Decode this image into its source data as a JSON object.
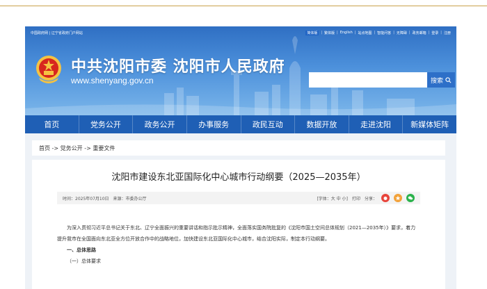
{
  "top_links": {
    "left": "中国政府网 | 辽宁省政府门户网站",
    "right": [
      {
        "label": "简体版",
        "highlight": true
      },
      {
        "label": "繁体版"
      },
      {
        "label": "English"
      },
      {
        "label": "站点地图"
      },
      {
        "label": "智能问答"
      },
      {
        "label": "无障碍"
      },
      {
        "label": "政务邮箱"
      },
      {
        "label": "登录"
      },
      {
        "label": "注册"
      }
    ]
  },
  "header": {
    "title": "中共沈阳市委 沈阳市人民政府",
    "url": "www.shenyang.gov.cn",
    "search_placeholder": "",
    "search_button": "搜索"
  },
  "nav": {
    "items": [
      "首页",
      "党务公开",
      "政务公开",
      "办事服务",
      "政民互动",
      "数据开放",
      "走进沈阳",
      "新媒体矩阵"
    ]
  },
  "breadcrumb": "首页 -> 党务公开 -> 重要文件",
  "article": {
    "title": "沈阳市建设东北亚国际化中心城市行动纲要（2025—2035年）",
    "time": "时间：2025年07月10日",
    "source": "来源：市委办公厅",
    "font_label": "[字体：大 中 小]",
    "print_label": "打印",
    "share_label": "分享：",
    "paragraph1": "为深入贯彻习近平总书记关于东北、辽宁全面振兴的重要讲话和指示批示精神，全面落实国务院批复的《沈阳市国土空间总体规划（2021—2035年）》要求，着力提升我市在全国面向东北亚全方位开放合作中的战略地位，加快建设东北亚国际化中心城市，结合沈阳实际，制定本行动纲要。",
    "heading1": "一、总体思路",
    "heading2": "（一）总体要求"
  },
  "colors": {
    "nav": "#1f5fb5",
    "search_button": "#2d6fc8",
    "share_weibo": "#e8453c",
    "share_qzone": "#f2a23a",
    "share_wechat": "#2bb24c"
  }
}
